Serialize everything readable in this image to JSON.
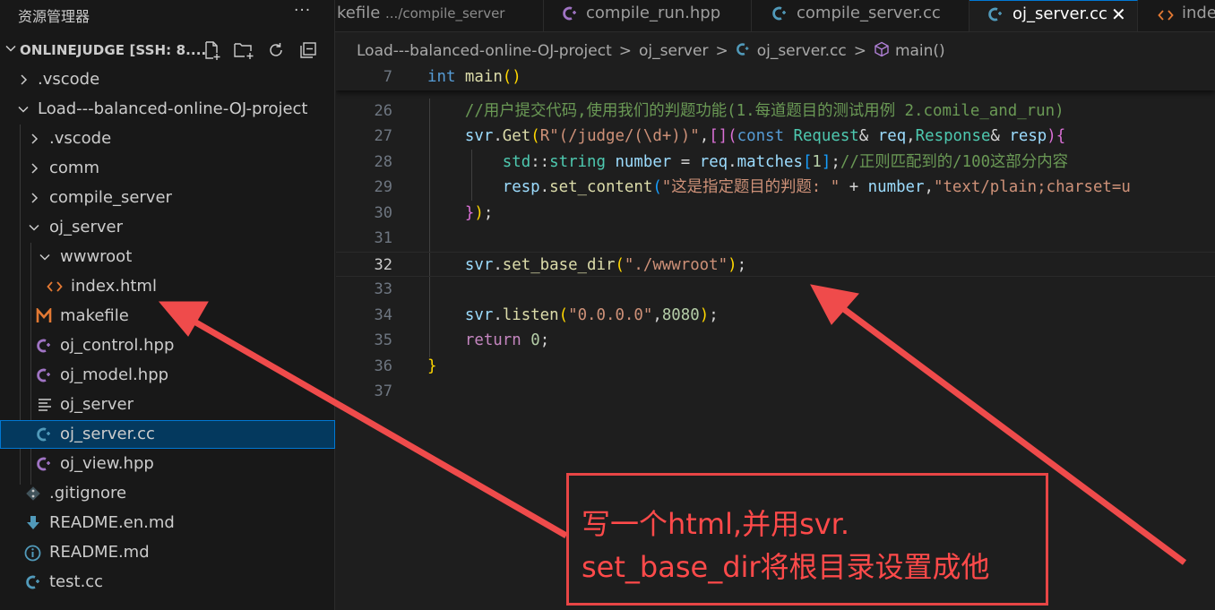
{
  "sidebar": {
    "title": "资源管理器",
    "more": "···",
    "workspace": "ONLINEJUDGE [SSH: 8....",
    "items": [
      {
        "label": ".vscode",
        "kind": "folder-closed"
      },
      {
        "label": "Load---balanced-online-OJ-project",
        "kind": "folder-open"
      },
      {
        "label": ".vscode",
        "kind": "folder-closed"
      },
      {
        "label": "comm",
        "kind": "folder-closed"
      },
      {
        "label": "compile_server",
        "kind": "folder-closed"
      },
      {
        "label": "oj_server",
        "kind": "folder-open"
      },
      {
        "label": "wwwroot",
        "kind": "folder-open"
      },
      {
        "label": "index.html",
        "kind": "html"
      },
      {
        "label": "makefile",
        "kind": "makefile"
      },
      {
        "label": "oj_control.hpp",
        "kind": "cpp-header"
      },
      {
        "label": "oj_model.hpp",
        "kind": "cpp-header"
      },
      {
        "label": "oj_server",
        "kind": "text"
      },
      {
        "label": "oj_server.cc",
        "kind": "cpp",
        "selected": true
      },
      {
        "label": "oj_view.hpp",
        "kind": "cpp-header"
      },
      {
        "label": ".gitignore",
        "kind": "git"
      },
      {
        "label": "README.en.md",
        "kind": "markdown-download"
      },
      {
        "label": "README.md",
        "kind": "info"
      },
      {
        "label": "test.cc",
        "kind": "cpp"
      }
    ]
  },
  "tabs": [
    {
      "label": "kefile",
      "description": ".../compile_server"
    },
    {
      "label": "compile_run.hpp"
    },
    {
      "label": "compile_server.cc"
    },
    {
      "label": "oj_server.cc",
      "active": true,
      "close": "✕"
    },
    {
      "label": "inde"
    }
  ],
  "breadcrumb": [
    "Load---balanced-online-OJ-project",
    "oj_server",
    "oj_server.cc",
    "main()"
  ],
  "editor": {
    "sticky": {
      "line": "7",
      "kw": "int",
      "fn": "main",
      "paren": "()"
    },
    "lines": {
      "26": "26",
      "27": "27",
      "28": "28",
      "29": "29",
      "30": "30",
      "31": "31",
      "32": "32",
      "33": "33",
      "34": "34",
      "35": "35",
      "36": "36",
      "37": "37"
    },
    "code": {
      "l26": "//用户提交代码,使用我们的判题功能(1.每道题目的测试用例 2.comile_and_run)",
      "l27_svr": "svr",
      "l27_get": "Get",
      "l27_R": "R",
      "l27_str": "\"(/judge/(\\d+))\"",
      "l27_const": "const",
      "l27_req_t": "Request",
      "l27_req": "req",
      "l27_resp_t": "Response",
      "l27_resp": "resp",
      "l28_std": "std",
      "l28_string": "string",
      "l28_number": "number",
      "l28_req": "req",
      "l28_matches": "matches",
      "l28_one": "1",
      "l28_comment": "//正则匹配到的/100这部分内容",
      "l29_resp": "resp",
      "l29_fn": "set_content",
      "l29_str": "\"这是指定题目的判题: \"",
      "l29_number": "number",
      "l29_str2": "\"text/plain;charset=u",
      "l32_svr": "svr",
      "l32_fn": "set_base_dir",
      "l32_str": "\"./wwwroot\"",
      "l34_svr": "svr",
      "l34_fn": "listen",
      "l34_str": "\"0.0.0.0\"",
      "l34_num": "8080",
      "l35_kw": "return",
      "l35_num": "0"
    }
  },
  "annotation": {
    "line1": "写一个html,并用svr.",
    "line2": "set_base_dir将根目录设置成他",
    "color": "#e84545"
  }
}
